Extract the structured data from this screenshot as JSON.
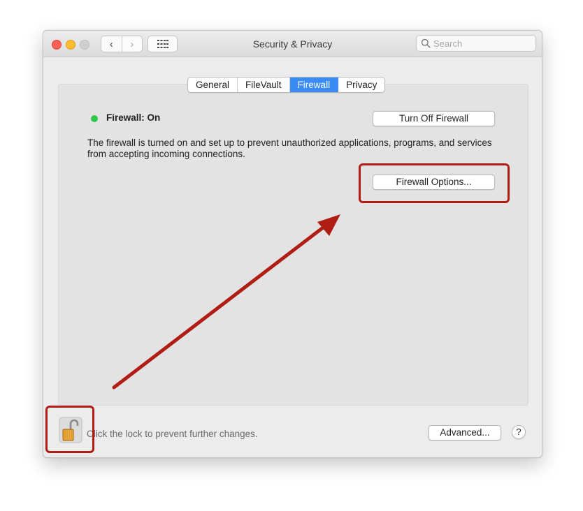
{
  "window": {
    "title": "Security & Privacy",
    "controls": [
      "close",
      "minimize",
      "zoom"
    ]
  },
  "toolbar": {
    "back_icon": "chevron-left-icon",
    "forward_icon": "chevron-right-icon",
    "back_glyph": "‹",
    "forward_glyph": "›",
    "grid_icon": "grid-icon",
    "search_placeholder": "Search",
    "search_icon": "search-icon"
  },
  "tabs": [
    {
      "label": "General",
      "active": false
    },
    {
      "label": "FileVault",
      "active": false
    },
    {
      "label": "Firewall",
      "active": true
    },
    {
      "label": "Privacy",
      "active": false
    }
  ],
  "firewall": {
    "status_label": "Firewall: On",
    "status_color": "#2fc84b",
    "turn_off_label": "Turn Off Firewall",
    "description": "The firewall is turned on and set up to prevent unauthorized applications, programs, and services from accepting incoming connections.",
    "options_label": "Firewall Options..."
  },
  "footer": {
    "lock_icon": "unlocked-padlock-icon",
    "lock_text": "Click the lock to prevent further changes.",
    "advanced_label": "Advanced...",
    "help_label": "?"
  },
  "annotations": {
    "highlight_color": "#b01d14",
    "arrow_color": "#b01d14"
  },
  "colors": {
    "accent": "#3a8bf3",
    "close": "#fe5f57",
    "minimize": "#febc2e",
    "zoom_inactive": "#cfcfcf"
  }
}
